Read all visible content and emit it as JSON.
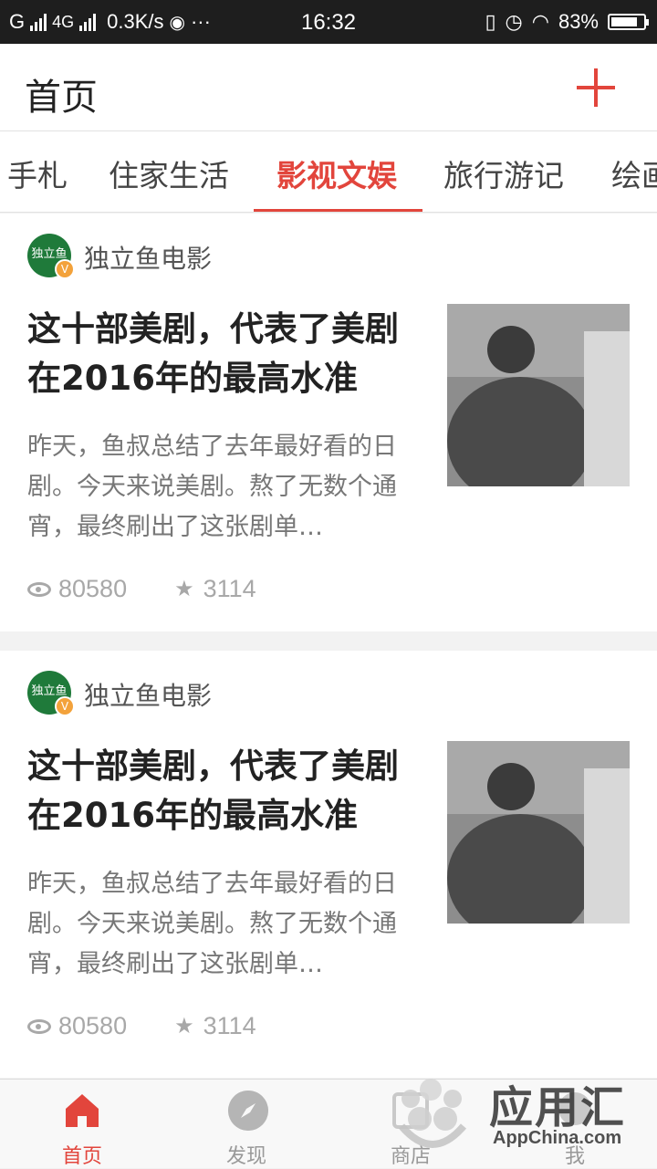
{
  "status_bar": {
    "carrier": "G",
    "network": "4G",
    "speed": "0.3K/s",
    "more": "···",
    "time": "16:32",
    "battery": "83%",
    "battery_level": 0.83
  },
  "header": {
    "title": "首页"
  },
  "tabs": [
    {
      "label": "手札",
      "active": false
    },
    {
      "label": "住家生活",
      "active": false
    },
    {
      "label": "影视文娱",
      "active": true
    },
    {
      "label": "旅行游记",
      "active": false
    },
    {
      "label": "绘画",
      "active": false
    }
  ],
  "articles": [
    {
      "author": "独立鱼电影",
      "avatar_text": "独立鱼",
      "badge": "V",
      "title": "这十部美剧，代表了美剧在2016年的最高水准",
      "summary": "昨天，鱼叔总结了去年最好看的日剧。今天来说美剧。熬了无数个通宵，最终刷出了这张剧单…",
      "views": "80580",
      "stars": "3114"
    },
    {
      "author": "独立鱼电影",
      "avatar_text": "独立鱼",
      "badge": "V",
      "title": "这十部美剧，代表了美剧在2016年的最高水准",
      "summary": "昨天，鱼叔总结了去年最好看的日剧。今天来说美剧。熬了无数个通宵，最终刷出了这张剧单…",
      "views": "80580",
      "stars": "3114"
    }
  ],
  "bottom_nav": [
    {
      "label": "首页",
      "icon": "home-icon",
      "active": true
    },
    {
      "label": "发现",
      "icon": "compass-icon",
      "active": false
    },
    {
      "label": "商店",
      "icon": "shop-icon",
      "active": false
    },
    {
      "label": "我",
      "icon": "me-icon",
      "active": false
    }
  ],
  "watermark": {
    "text": "应用汇",
    "sub": "AppChina.com"
  },
  "colors": {
    "accent": "#e2453c",
    "status_bar": "#1e1e1e",
    "avatar": "#1f7a3a"
  }
}
